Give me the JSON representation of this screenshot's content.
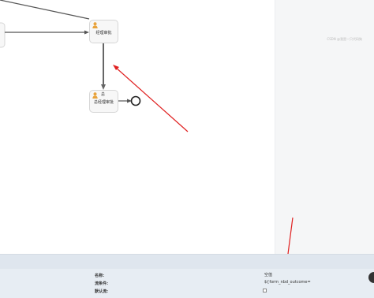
{
  "canvas": {
    "task1_label": "经理审批",
    "task2_badge": "总",
    "task2_label": "总经理审批"
  },
  "properties": {
    "name_label": "名称:",
    "name_value": "空值",
    "condition_label": "流条件:",
    "condition_value": "${form_nbd_outcome=",
    "default_label": "默认流:"
  },
  "watermark": "CSDN @我是一只代码狗",
  "colors": {
    "annotation_arrow": "#e02020",
    "task_fill": "#f7f7f7",
    "panel": "#f5f6f7",
    "bottom_panel": "#e7edf3"
  }
}
